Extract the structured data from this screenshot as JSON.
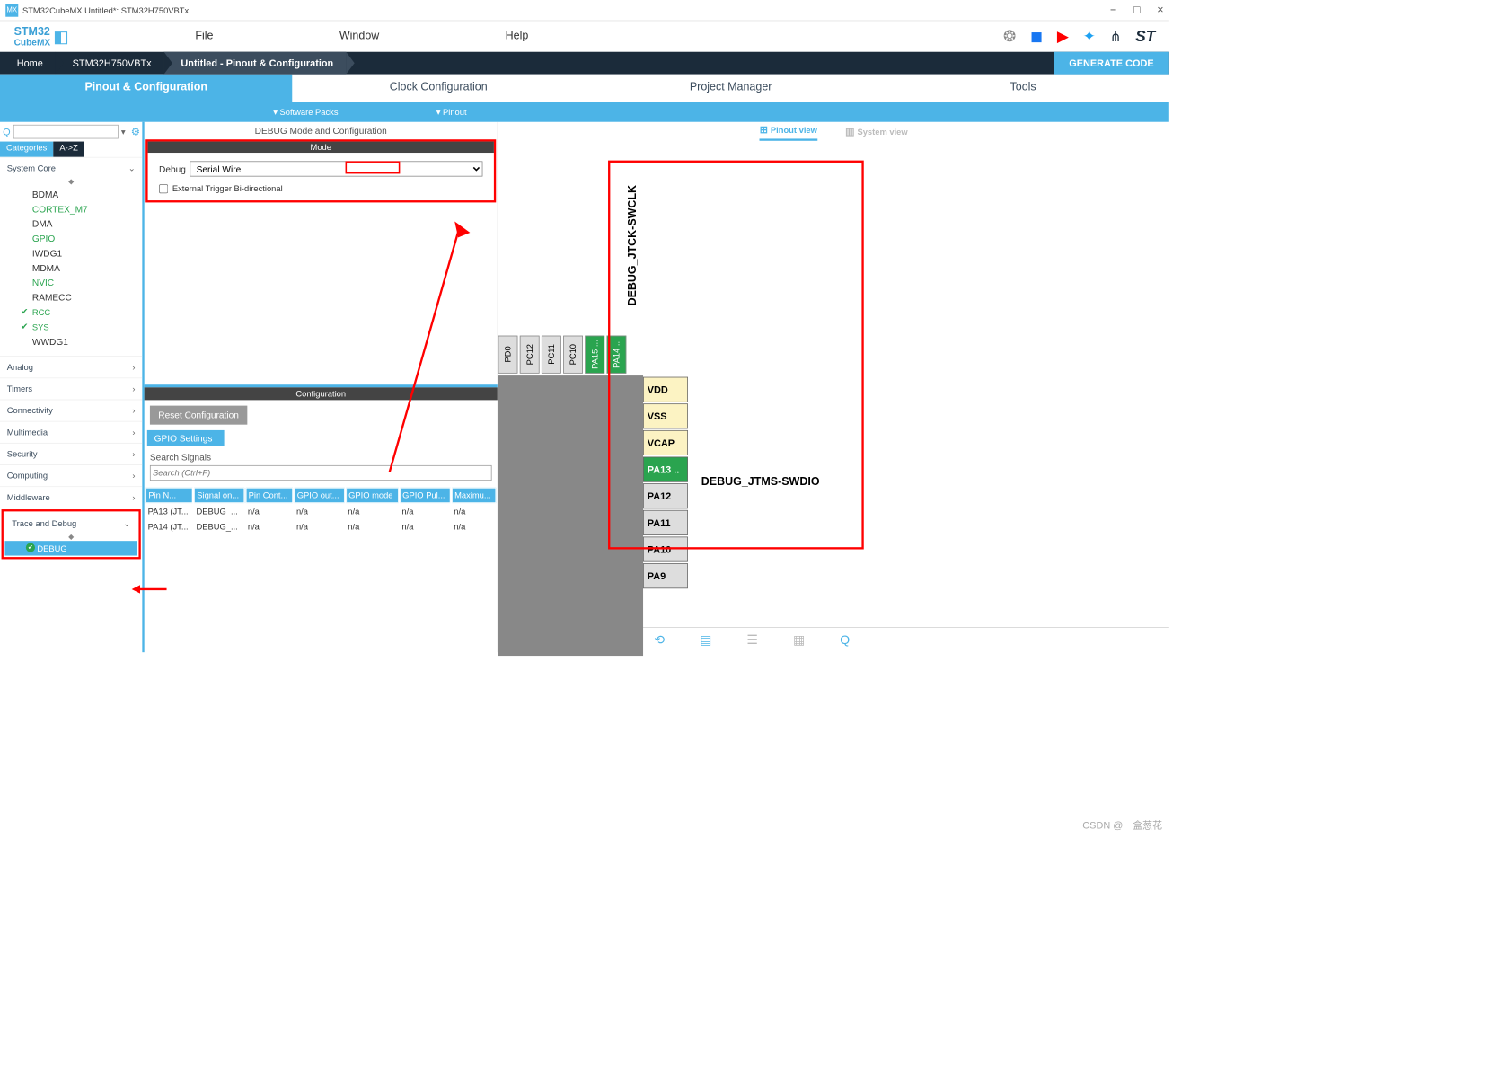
{
  "title": "STM32CubeMX Untitled*: STM32H750VBTx",
  "logo": {
    "top": "STM32",
    "bot": "CubeMX"
  },
  "menu": {
    "file": "File",
    "window": "Window",
    "help": "Help"
  },
  "breadcrumb": {
    "home": "Home",
    "chip": "STM32H750VBTx",
    "page": "Untitled - Pinout & Configuration"
  },
  "generate": "GENERATE CODE",
  "tabs": {
    "pinout": "Pinout & Configuration",
    "clock": "Clock Configuration",
    "project": "Project Manager",
    "tools": "Tools"
  },
  "subbar": {
    "soft": "Software Packs",
    "pinout": "Pinout"
  },
  "cat_tabs": {
    "cat": "Categories",
    "az": "A->Z"
  },
  "cats": {
    "syscore": "System Core",
    "items": [
      "BDMA",
      "CORTEX_M7",
      "DMA",
      "GPIO",
      "IWDG1",
      "MDMA",
      "NVIC",
      "RAMECC",
      "RCC",
      "SYS",
      "WWDG1"
    ],
    "analog": "Analog",
    "timers": "Timers",
    "conn": "Connectivity",
    "multi": "Multimedia",
    "sec": "Security",
    "comp": "Computing",
    "mw": "Middleware",
    "trace": "Trace and Debug",
    "debug": "DEBUG"
  },
  "mid": {
    "title": "DEBUG Mode and Configuration",
    "mode": "Mode",
    "debug_lbl": "Debug",
    "debug_val": "Serial Wire",
    "ext": "External Trigger Bi-directional",
    "config": "Configuration",
    "reset": "Reset Configuration",
    "gpio": "GPIO Settings",
    "search": "Search Signals",
    "search_ph": "Search (Ctrl+F)",
    "cols": [
      "Pin N...",
      "Signal on...",
      "Pin Cont...",
      "GPIO out...",
      "GPIO mode",
      "GPIO Pul...",
      "Maximu..."
    ],
    "rows": [
      [
        "PA13 (JT...",
        "DEBUG_...",
        "n/a",
        "n/a",
        "n/a",
        "n/a",
        "n/a"
      ],
      [
        "PA14 (JT...",
        "DEBUG_...",
        "n/a",
        "n/a",
        "n/a",
        "n/a",
        "n/a"
      ]
    ]
  },
  "view": {
    "pin": "Pinout view",
    "sys": "System view"
  },
  "topPins": [
    "PD0",
    "PC12",
    "PC11",
    "PC10",
    "PA15 ...",
    "PA14 .."
  ],
  "rPins": [
    "VDD",
    "VSS",
    "VCAP",
    "PA13 ..",
    "PA12",
    "PA11",
    "PA10",
    "PA9"
  ],
  "vlabel": "DEBUG_JTCK-SWCLK",
  "hlabel": "DEBUG_JTMS-SWDIO",
  "watermark": "CSDN @一盒葱花"
}
